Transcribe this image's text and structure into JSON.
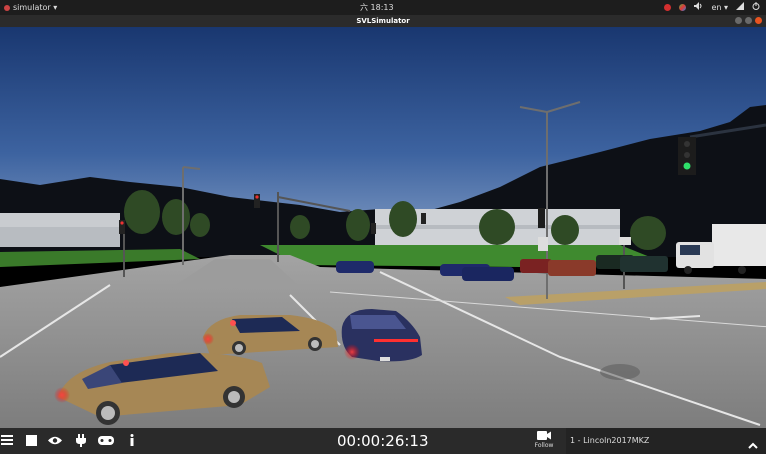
{
  "topbar": {
    "app_name": "simulator ▾",
    "clock": "六 18:13",
    "lang": "en ▾",
    "icons": [
      "red-app-icon",
      "chrome-icon",
      "sound-icon",
      "network-icon",
      "power-icon"
    ]
  },
  "window": {
    "title": "SVLSimulator"
  },
  "toolbar": {
    "timer": "00:00:26:13",
    "follow_label": "Follow",
    "vehicle": "1 - Lincoln2017MKZ",
    "icons": [
      "menu-icon",
      "stop-icon",
      "eye-icon",
      "plug-icon",
      "gamepad-icon",
      "info-icon",
      "camera-icon",
      "chevron-up-icon"
    ]
  },
  "colors": {
    "sky_top": "#1c3a7a",
    "sky_horizon": "#6a88b8",
    "road": "#8a8a8a",
    "toolbar_bg": "#2a2a2a"
  }
}
